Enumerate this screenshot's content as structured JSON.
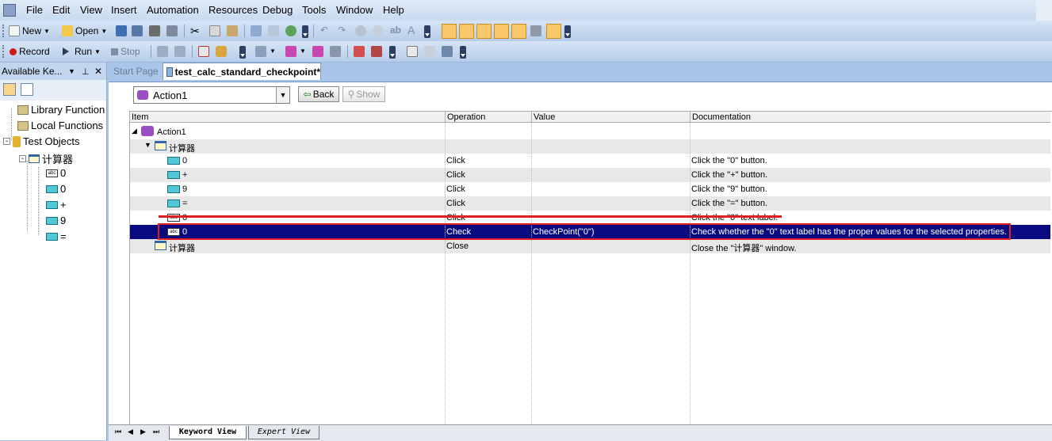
{
  "menu": [
    "File",
    "Edit",
    "View",
    "Insert",
    "Automation",
    "Resources",
    "Debug",
    "Tools",
    "Window",
    "Help"
  ],
  "toolbar1": {
    "new_label": "New",
    "open_label": "Open"
  },
  "toolbar2": {
    "record_label": "Record",
    "run_label": "Run",
    "stop_label": "Stop"
  },
  "left_panel": {
    "title": "Available Ke...",
    "tree": [
      {
        "label": "Library Function"
      },
      {
        "label": "Local Functions"
      },
      {
        "label": "Test Objects"
      },
      {
        "label": "计算器"
      },
      {
        "label": "0"
      },
      {
        "label": "0"
      },
      {
        "label": "+"
      },
      {
        "label": "9"
      },
      {
        "label": "="
      }
    ]
  },
  "tabs": {
    "start_page": "Start Page",
    "test": "test_calc_standard_checkpoint*"
  },
  "action_select": {
    "value": "Action1",
    "back_label": "Back",
    "show_label": "Show"
  },
  "grid": {
    "headers": [
      "Item",
      "Operation",
      "Value",
      "Documentation"
    ],
    "rows": [
      {
        "item": "Action1",
        "operation": "",
        "value": "",
        "doc": ""
      },
      {
        "item": "计算器",
        "operation": "",
        "value": "",
        "doc": ""
      },
      {
        "item": "0",
        "operation": "Click",
        "value": "",
        "doc": "Click the \"0\" button."
      },
      {
        "item": "+",
        "operation": "Click",
        "value": "",
        "doc": "Click the \"+\" button."
      },
      {
        "item": "9",
        "operation": "Click",
        "value": "",
        "doc": "Click the \"9\" button."
      },
      {
        "item": "=",
        "operation": "Click",
        "value": "",
        "doc": "Click the \"=\" button."
      },
      {
        "item": "0",
        "operation": "Click",
        "value": "",
        "doc": "Click the \"0\" text label."
      },
      {
        "item": "0",
        "operation": "Check",
        "value": "CheckPoint(\"0\")",
        "doc": "Check whether the \"0\" text label has the proper values for the selected properties."
      },
      {
        "item": "计算器",
        "operation": "Close",
        "value": "",
        "doc": "Close the \"计算器\" window."
      }
    ]
  },
  "bottom_tabs": {
    "keyword": "Keyword View",
    "expert": "Expert View"
  },
  "colors": {
    "selection": "#0a0a80",
    "annotation_red": "#e02020"
  }
}
